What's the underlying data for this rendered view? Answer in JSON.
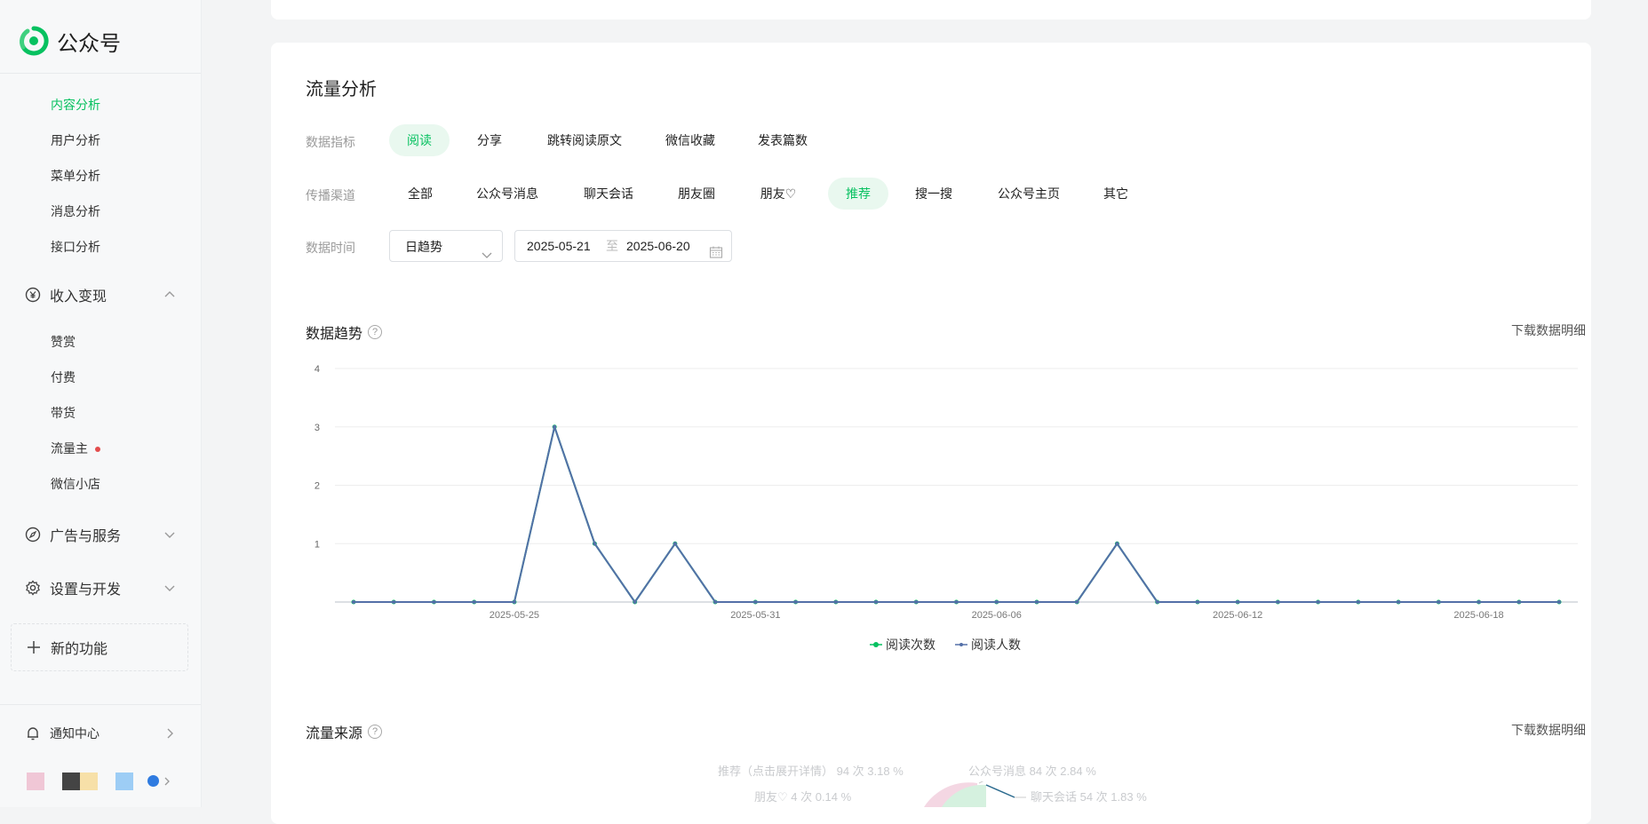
{
  "app": {
    "name": "公众号"
  },
  "sidebar": {
    "analysis_items": [
      {
        "label": "内容分析",
        "active": true
      },
      {
        "label": "用户分析"
      },
      {
        "label": "菜单分析"
      },
      {
        "label": "消息分析"
      },
      {
        "label": "接口分析"
      }
    ],
    "monetize": {
      "label": "收入变现",
      "icon": "yen-circle-icon",
      "expanded": true
    },
    "monetize_items": [
      {
        "label": "赞赏"
      },
      {
        "label": "付费"
      },
      {
        "label": "带货"
      },
      {
        "label": "流量主",
        "badge": "red-dot"
      },
      {
        "label": "微信小店"
      }
    ],
    "ads": {
      "label": "广告与服务",
      "icon": "compass-icon"
    },
    "settings": {
      "label": "设置与开发",
      "icon": "gear-icon"
    },
    "new_features": {
      "label": "新的功能",
      "icon": "plus-icon"
    },
    "notice": {
      "label": "通知中心",
      "icon": "bell-icon"
    },
    "user": {
      "verified_icon": "verified-icon"
    }
  },
  "main": {
    "title": "流量分析",
    "filters": {
      "metric_label": "数据指标",
      "metrics": [
        "阅读",
        "分享",
        "跳转阅读原文",
        "微信收藏",
        "发表篇数"
      ],
      "metric_selected": "阅读",
      "channel_label": "传播渠道",
      "channels": [
        "全部",
        "公众号消息",
        "聊天会话",
        "朋友圈",
        "朋友♡",
        "推荐",
        "搜一搜",
        "公众号主页",
        "其它"
      ],
      "channel_selected": "推荐",
      "time_label": "数据时间",
      "granularity": "日趋势",
      "date_start": "2025-05-21",
      "date_sep": "至",
      "date_end": "2025-06-20"
    },
    "trend": {
      "title": "数据趋势",
      "help": "?",
      "download": "下载数据明细"
    },
    "source": {
      "title": "流量来源",
      "help": "?",
      "download": "下载数据明细"
    },
    "pie_labels": [
      "推荐（点击展开详情） 94 次 3.18 %",
      "朋友♡ 4 次 0.14 %",
      "公众号消息 84 次 2.84 %",
      "聊天会话 54 次 1.83 %"
    ]
  },
  "chart_data": {
    "type": "line",
    "x": [
      "2025-05-21",
      "2025-05-22",
      "2025-05-23",
      "2025-05-24",
      "2025-05-25",
      "2025-05-26",
      "2025-05-27",
      "2025-05-28",
      "2025-05-29",
      "2025-05-30",
      "2025-05-31",
      "2025-06-01",
      "2025-06-02",
      "2025-06-03",
      "2025-06-04",
      "2025-06-05",
      "2025-06-06",
      "2025-06-07",
      "2025-06-08",
      "2025-06-09",
      "2025-06-10",
      "2025-06-11",
      "2025-06-12",
      "2025-06-13",
      "2025-06-14",
      "2025-06-15",
      "2025-06-16",
      "2025-06-17",
      "2025-06-18",
      "2025-06-19",
      "2025-06-20"
    ],
    "x_tick_labels": [
      "2025-05-25",
      "2025-05-31",
      "2025-06-06",
      "2025-06-12",
      "2025-06-18"
    ],
    "series": [
      {
        "name": "阅读次数",
        "color": "#07c160",
        "values": [
          0,
          0,
          0,
          0,
          0,
          3,
          1,
          0,
          1,
          0,
          0,
          0,
          0,
          0,
          0,
          0,
          0,
          0,
          0,
          1,
          0,
          0,
          0,
          0,
          0,
          0,
          0,
          0,
          0,
          0,
          0
        ]
      },
      {
        "name": "阅读人数",
        "color": "#5470a8",
        "values": [
          0,
          0,
          0,
          0,
          0,
          3,
          1,
          0,
          1,
          0,
          0,
          0,
          0,
          0,
          0,
          0,
          0,
          0,
          0,
          1,
          0,
          0,
          0,
          0,
          0,
          0,
          0,
          0,
          0,
          0,
          0
        ]
      }
    ],
    "ylim": [
      0,
      4
    ],
    "y_ticks": [
      1,
      2,
      3,
      4
    ],
    "grid": true,
    "legend": "bottom-center"
  }
}
